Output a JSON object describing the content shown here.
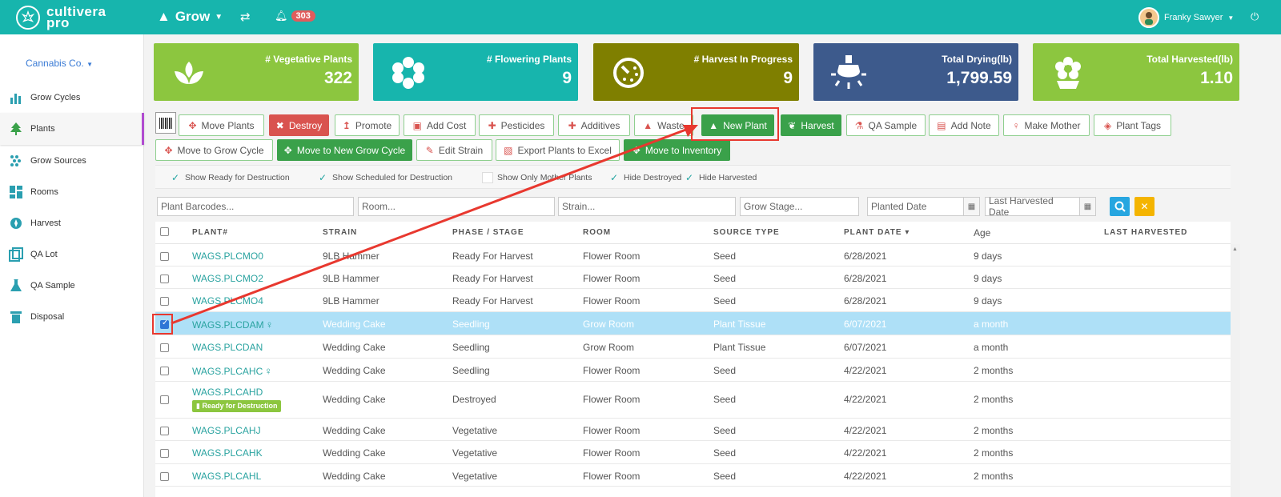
{
  "app": {
    "logo_text_1": "cultivera",
    "logo_text_2": "pro",
    "nav_grow": "Grow",
    "notifications_count": "303",
    "user_name": "Franky Sawyer"
  },
  "sidebar": {
    "company": "Cannabis Co.",
    "items": [
      {
        "label": "Grow Cycles"
      },
      {
        "label": "Plants"
      },
      {
        "label": "Grow Sources"
      },
      {
        "label": "Rooms"
      },
      {
        "label": "Harvest"
      },
      {
        "label": "QA Lot"
      },
      {
        "label": "QA Sample"
      },
      {
        "label": "Disposal"
      }
    ]
  },
  "cards": [
    {
      "label": "# Vegetative Plants",
      "value": "322",
      "color": "#8cc63f"
    },
    {
      "label": "# Flowering Plants",
      "value": "9",
      "color": "#17b5ad"
    },
    {
      "label": "# Harvest In Progress",
      "value": "9",
      "color": "#7f7f00"
    },
    {
      "label": "Total Drying(lb)",
      "value": "1,799.59",
      "color": "#3d5a8c"
    },
    {
      "label": "Total Harvested(lb)",
      "value": "1.10",
      "color": "#8cc63f"
    }
  ],
  "toolbar": {
    "move_plants": "Move Plants",
    "destroy": "Destroy",
    "promote": "Promote",
    "add_cost": "Add Cost",
    "pesticides": "Pesticides",
    "additives": "Additives",
    "waste": "Waste",
    "new_plant": "New Plant",
    "harvest": "Harvest",
    "qa_sample": "QA Sample",
    "add_note": "Add Note",
    "make_mother": "Make Mother",
    "plant_tags": "Plant Tags",
    "move_to_grow_cycle": "Move to Grow Cycle",
    "move_to_new_grow_cycle": "Move to New Grow Cycle",
    "edit_strain": "Edit Strain",
    "export_plants": "Export Plants to Excel",
    "move_to_inventory": "Move to Inventory"
  },
  "filters": {
    "show_ready": "Show Ready for Destruction",
    "show_scheduled": "Show Scheduled for Destruction",
    "show_mother": "Show Only Mother Plants",
    "hide_destroyed": "Hide Destroyed",
    "hide_harvested": "Hide Harvested"
  },
  "search": {
    "plant_barcodes": "Plant Barcodes...",
    "room": "Room...",
    "strain": "Strain...",
    "grow_stage": "Grow Stage...",
    "planted_date": "Planted Date",
    "last_harvested_date": "Last Harvested Date"
  },
  "table": {
    "headers": {
      "plant": "PLANT#",
      "strain": "STRAIN",
      "phase": "PHASE / STAGE",
      "room": "ROOM",
      "source": "SOURCE TYPE",
      "date": "PLANT DATE ▾",
      "age": "Age",
      "last": "LAST HARVESTED"
    },
    "rows": [
      {
        "plant": "WAGS.PLCMO0",
        "strain": "9LB Hammer",
        "phase": "Ready For Harvest",
        "room": "Flower Room",
        "source": "Seed",
        "date": "6/28/2021",
        "age": "9 days"
      },
      {
        "plant": "WAGS.PLCMO2",
        "strain": "9LB Hammer",
        "phase": "Ready For Harvest",
        "room": "Flower Room",
        "source": "Seed",
        "date": "6/28/2021",
        "age": "9 days"
      },
      {
        "plant": "WAGS.PLCMO4",
        "strain": "9LB Hammer",
        "phase": "Ready For Harvest",
        "room": "Flower Room",
        "source": "Seed",
        "date": "6/28/2021",
        "age": "9 days"
      },
      {
        "plant": "WAGS.PLCDAM",
        "strain": "Wedding Cake",
        "phase": "Seedling",
        "room": "Grow Room",
        "source": "Plant Tissue",
        "date": "6/07/2021",
        "age": "a month"
      },
      {
        "plant": "WAGS.PLCDAN",
        "strain": "Wedding Cake",
        "phase": "Seedling",
        "room": "Grow Room",
        "source": "Plant Tissue",
        "date": "6/07/2021",
        "age": "a month"
      },
      {
        "plant": "WAGS.PLCAHC",
        "strain": "Wedding Cake",
        "phase": "Seedling",
        "room": "Flower Room",
        "source": "Seed",
        "date": "4/22/2021",
        "age": "2 months"
      },
      {
        "plant": "WAGS.PLCAHD",
        "strain": "Wedding Cake",
        "phase": "Destroyed",
        "room": "Flower Room",
        "source": "Seed",
        "date": "4/22/2021",
        "age": "2 months",
        "badge": "Ready for Destruction"
      },
      {
        "plant": "WAGS.PLCAHJ",
        "strain": "Wedding Cake",
        "phase": "Vegetative",
        "room": "Flower Room",
        "source": "Seed",
        "date": "4/22/2021",
        "age": "2 months"
      },
      {
        "plant": "WAGS.PLCAHK",
        "strain": "Wedding Cake",
        "phase": "Vegetative",
        "room": "Flower Room",
        "source": "Seed",
        "date": "4/22/2021",
        "age": "2 months"
      },
      {
        "plant": "WAGS.PLCAHL",
        "strain": "Wedding Cake",
        "phase": "Vegetative",
        "room": "Flower Room",
        "source": "Seed",
        "date": "4/22/2021",
        "age": "2 months"
      }
    ]
  }
}
